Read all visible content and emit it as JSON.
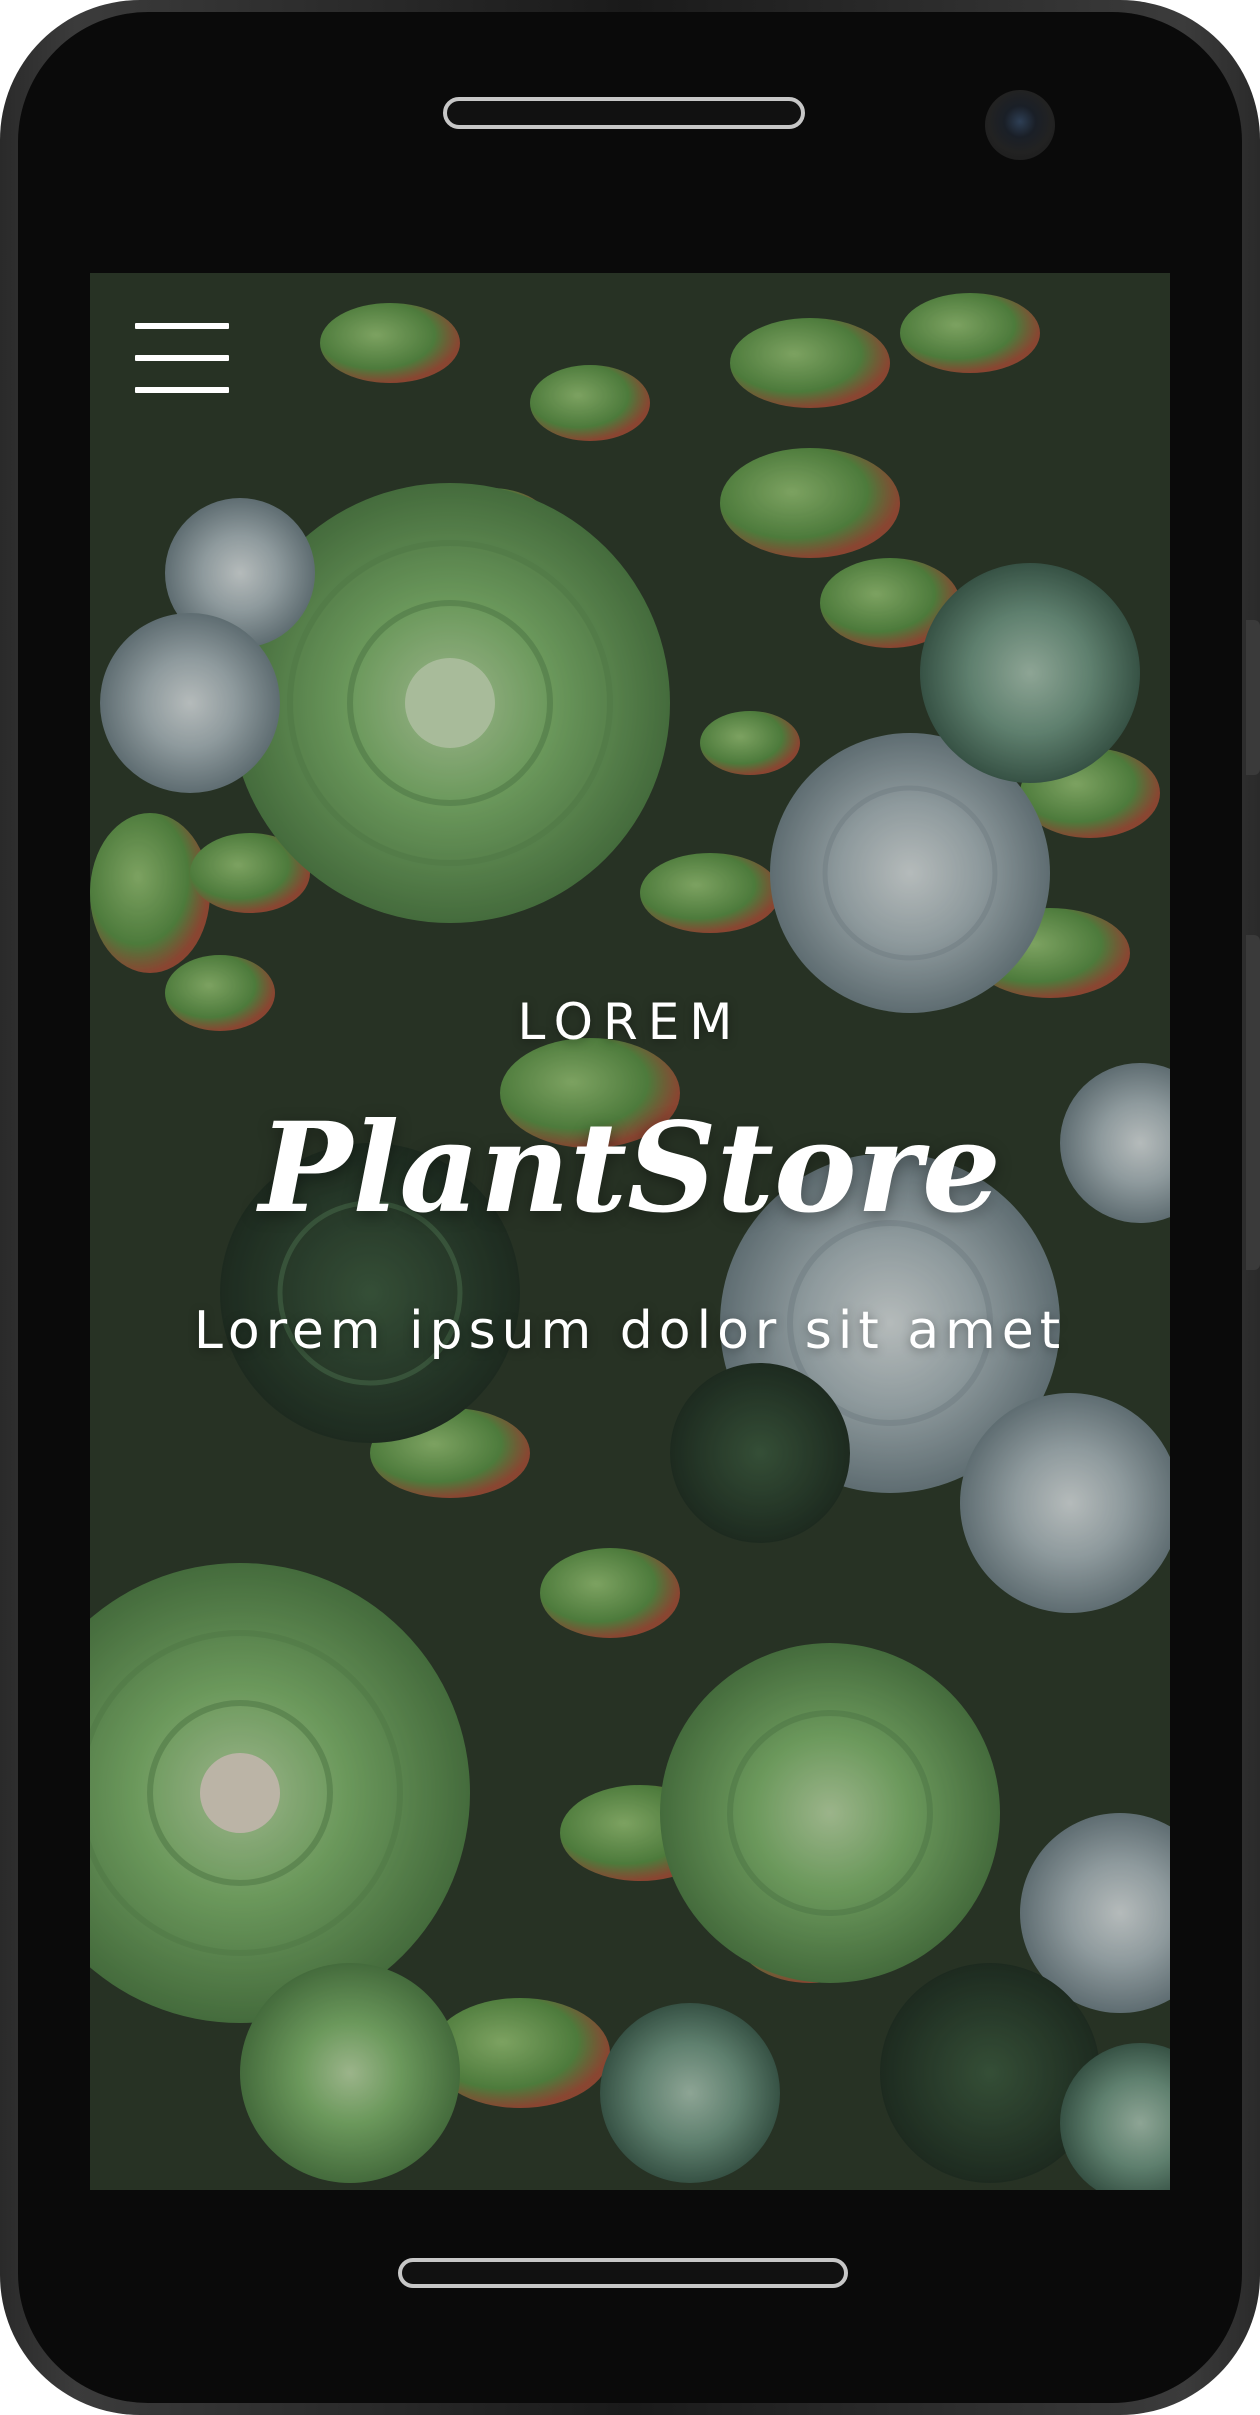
{
  "hero": {
    "eyebrow": "LOREM",
    "title": "PlantStore",
    "subtitle": "Lorem ipsum dolor sit amet"
  },
  "menu": {
    "icon": "hamburger-menu-icon"
  },
  "colors": {
    "text": "#ffffff",
    "device_frame": "#0a0a0a"
  }
}
